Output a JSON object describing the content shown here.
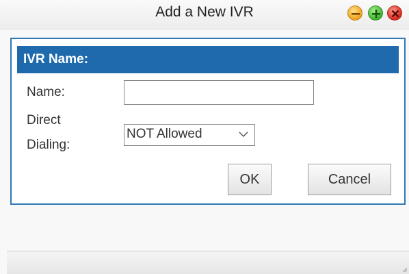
{
  "window": {
    "title": "Add a New IVR",
    "controls": [
      "minimize-icon",
      "maximize-icon",
      "close-icon"
    ]
  },
  "form": {
    "section_title": "IVR Name:",
    "name_label": "Name:",
    "name_value": "",
    "direct_dialing_label_line1": "Direct",
    "direct_dialing_label_line2": "Dialing:",
    "direct_dialing_value": "NOT Allowed"
  },
  "buttons": {
    "ok": "OK",
    "cancel": "Cancel"
  },
  "colors": {
    "header_bg": "#1f6aad",
    "panel_border": "#2f79b5"
  }
}
